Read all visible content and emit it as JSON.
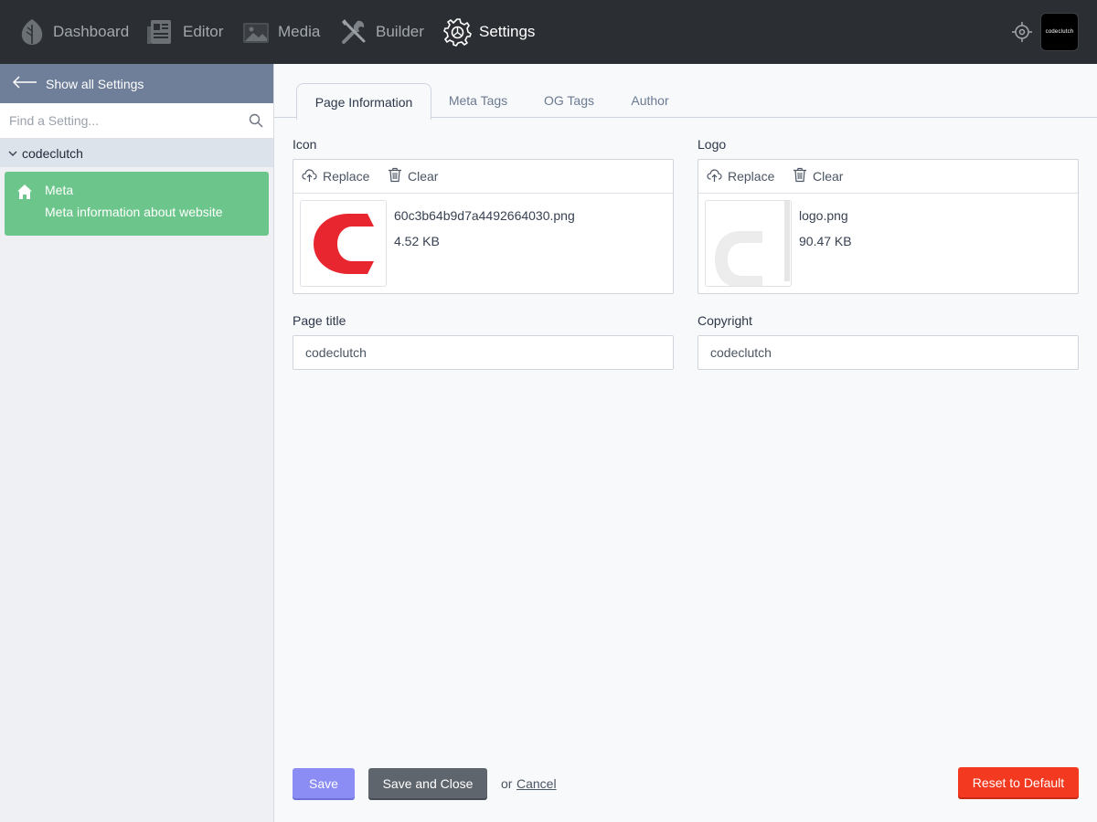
{
  "nav": {
    "items": [
      {
        "label": "Dashboard",
        "icon": "leaf-icon"
      },
      {
        "label": "Editor",
        "icon": "newspaper-icon"
      },
      {
        "label": "Media",
        "icon": "image-icon"
      },
      {
        "label": "Builder",
        "icon": "tools-icon"
      },
      {
        "label": "Settings",
        "icon": "gear-icon"
      }
    ],
    "active": "Settings",
    "avatar_text": "codeclutch"
  },
  "sidebar": {
    "back_label": "Show all Settings",
    "search_placeholder": "Find a Setting...",
    "group": "codeclutch",
    "item": {
      "title": "Meta",
      "description": "Meta information about website",
      "icon": "home-icon"
    }
  },
  "tabs": [
    "Page Information",
    "Meta Tags",
    "OG Tags",
    "Author"
  ],
  "active_tab": "Page Information",
  "fields": {
    "icon": {
      "label": "Icon",
      "replace_label": "Replace",
      "clear_label": "Clear",
      "file_name": "60c3b64b9d7a4492664030.png",
      "file_size": "4.52 KB"
    },
    "logo": {
      "label": "Logo",
      "replace_label": "Replace",
      "clear_label": "Clear",
      "file_name": "logo.png",
      "file_size": "90.47 KB"
    },
    "page_title": {
      "label": "Page title",
      "value": "codeclutch"
    },
    "copyright": {
      "label": "Copyright",
      "value": "codeclutch"
    }
  },
  "actions": {
    "save": "Save",
    "save_close": "Save and Close",
    "or": "or",
    "cancel": "Cancel",
    "reset": "Reset to Default"
  },
  "colors": {
    "topbar": "#2b2f33",
    "sidebar_header": "#6f7f99",
    "active_item": "#6cc58a",
    "save_button": "#8b8cf4",
    "save_close_button": "#5f656d",
    "reset_button": "#f3391f",
    "icon_brand_red": "#e8262f"
  }
}
